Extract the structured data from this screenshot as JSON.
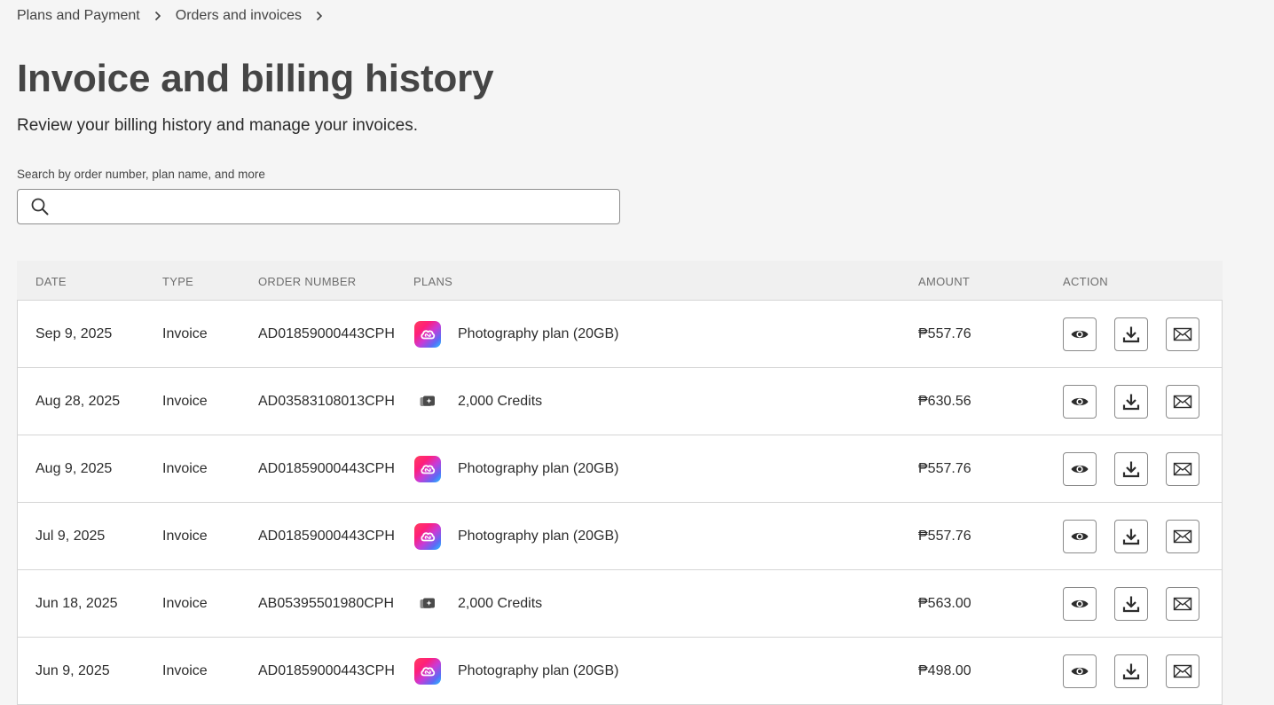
{
  "breadcrumb": {
    "items": [
      "Plans and Payment",
      "Orders and invoices"
    ]
  },
  "header": {
    "title": "Invoice and billing history",
    "subtitle": "Review your billing history and manage your invoices."
  },
  "search": {
    "label": "Search by order number, plan name, and more",
    "value": "",
    "placeholder": ""
  },
  "table": {
    "columns": {
      "date": "DATE",
      "type": "TYPE",
      "order": "ORDER NUMBER",
      "plans": "PLANS",
      "amount": "AMOUNT",
      "action": "ACTION"
    },
    "rows": [
      {
        "date": "Sep 9, 2025",
        "type": "Invoice",
        "order": "AD01859000443CPH",
        "plan_icon": "creative-cloud-icon",
        "plan": "Photography plan (20GB)",
        "amount": "₱557.76"
      },
      {
        "date": "Aug 28, 2025",
        "type": "Invoice",
        "order": "AD03583108013CPH",
        "plan_icon": "credits-icon",
        "plan": "2,000 Credits",
        "amount": "₱630.56"
      },
      {
        "date": "Aug 9, 2025",
        "type": "Invoice",
        "order": "AD01859000443CPH",
        "plan_icon": "creative-cloud-icon",
        "plan": "Photography plan (20GB)",
        "amount": "₱557.76"
      },
      {
        "date": "Jul 9, 2025",
        "type": "Invoice",
        "order": "AD01859000443CPH",
        "plan_icon": "creative-cloud-icon",
        "plan": "Photography plan (20GB)",
        "amount": "₱557.76"
      },
      {
        "date": "Jun 18, 2025",
        "type": "Invoice",
        "order": "AB05395501980CPH",
        "plan_icon": "credits-icon",
        "plan": "2,000 Credits",
        "amount": "₱563.00"
      },
      {
        "date": "Jun 9, 2025",
        "type": "Invoice",
        "order": "AD01859000443CPH",
        "plan_icon": "creative-cloud-icon",
        "plan": "Photography plan (20GB)",
        "amount": "₱498.00"
      }
    ],
    "actions": [
      "view-icon",
      "download-icon",
      "email-icon"
    ]
  },
  "colors": {
    "background": "#f5f5f5",
    "header_background": "#f0f0f0",
    "border": "#d5d5d5",
    "text": "#2c2c2c"
  }
}
